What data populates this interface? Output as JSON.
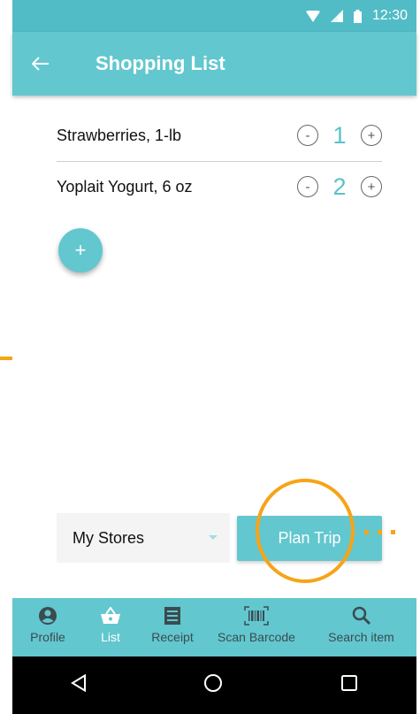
{
  "status_bar": {
    "time": "12:30"
  },
  "app_bar": {
    "title": "Shopping List"
  },
  "items": [
    {
      "name": "Strawberries, 1-lb",
      "qty": "1",
      "minus": "-",
      "plus": "+"
    },
    {
      "name": "Yoplait Yogurt, 6 oz",
      "qty": "2",
      "minus": "-",
      "plus": "+"
    }
  ],
  "fab": {
    "label": "+"
  },
  "stores": {
    "selected": "My Stores"
  },
  "plan_trip": {
    "label": "Plan Trip"
  },
  "bottom_nav": [
    {
      "label": "Profile",
      "icon": "profile-icon"
    },
    {
      "label": "List",
      "icon": "basket-icon"
    },
    {
      "label": "Receipt",
      "icon": "receipt-icon"
    },
    {
      "label": "Scan Barcode",
      "icon": "barcode-icon"
    },
    {
      "label": "Search item",
      "icon": "search-icon"
    }
  ],
  "colors": {
    "primary": "#62c7cf",
    "status_bar": "#51bcc6",
    "accent_orange": "#f6a418",
    "qty_text": "#5bc2cb"
  }
}
